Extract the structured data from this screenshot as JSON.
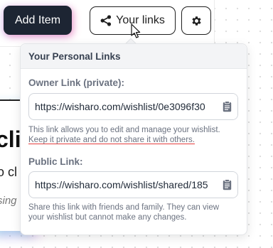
{
  "toolbar": {
    "add_item_label": "Add Item",
    "your_links_label": "Your links"
  },
  "background": {
    "heading_fragment": "cli",
    "subtitle_fragment": "o cl",
    "italic_fragment": "sing"
  },
  "popover": {
    "title": "Your Personal Links",
    "owner": {
      "label": "Owner Link (private):",
      "value": "https://wisharo.com/wishlist/0e3096f30",
      "help_line1": "This link allows you to edit and manage your wishlist.",
      "help_line2": "Keep it private and do not share it with others."
    },
    "public": {
      "label": "Public Link:",
      "value": "https://wisharo.com/wishlist/shared/185",
      "help": "Share this link with friends and family. They can view your wishlist but cannot make any changes."
    }
  },
  "icons": {
    "share": "share-icon",
    "settings": "gear-icon",
    "copy": "clipboard-icon",
    "cursor": "pointer-cursor-icon"
  },
  "colors": {
    "primary_button": "#1d2533",
    "popover_header_bg": "#f3f4f6",
    "warning_underline": "#e53e3e"
  }
}
